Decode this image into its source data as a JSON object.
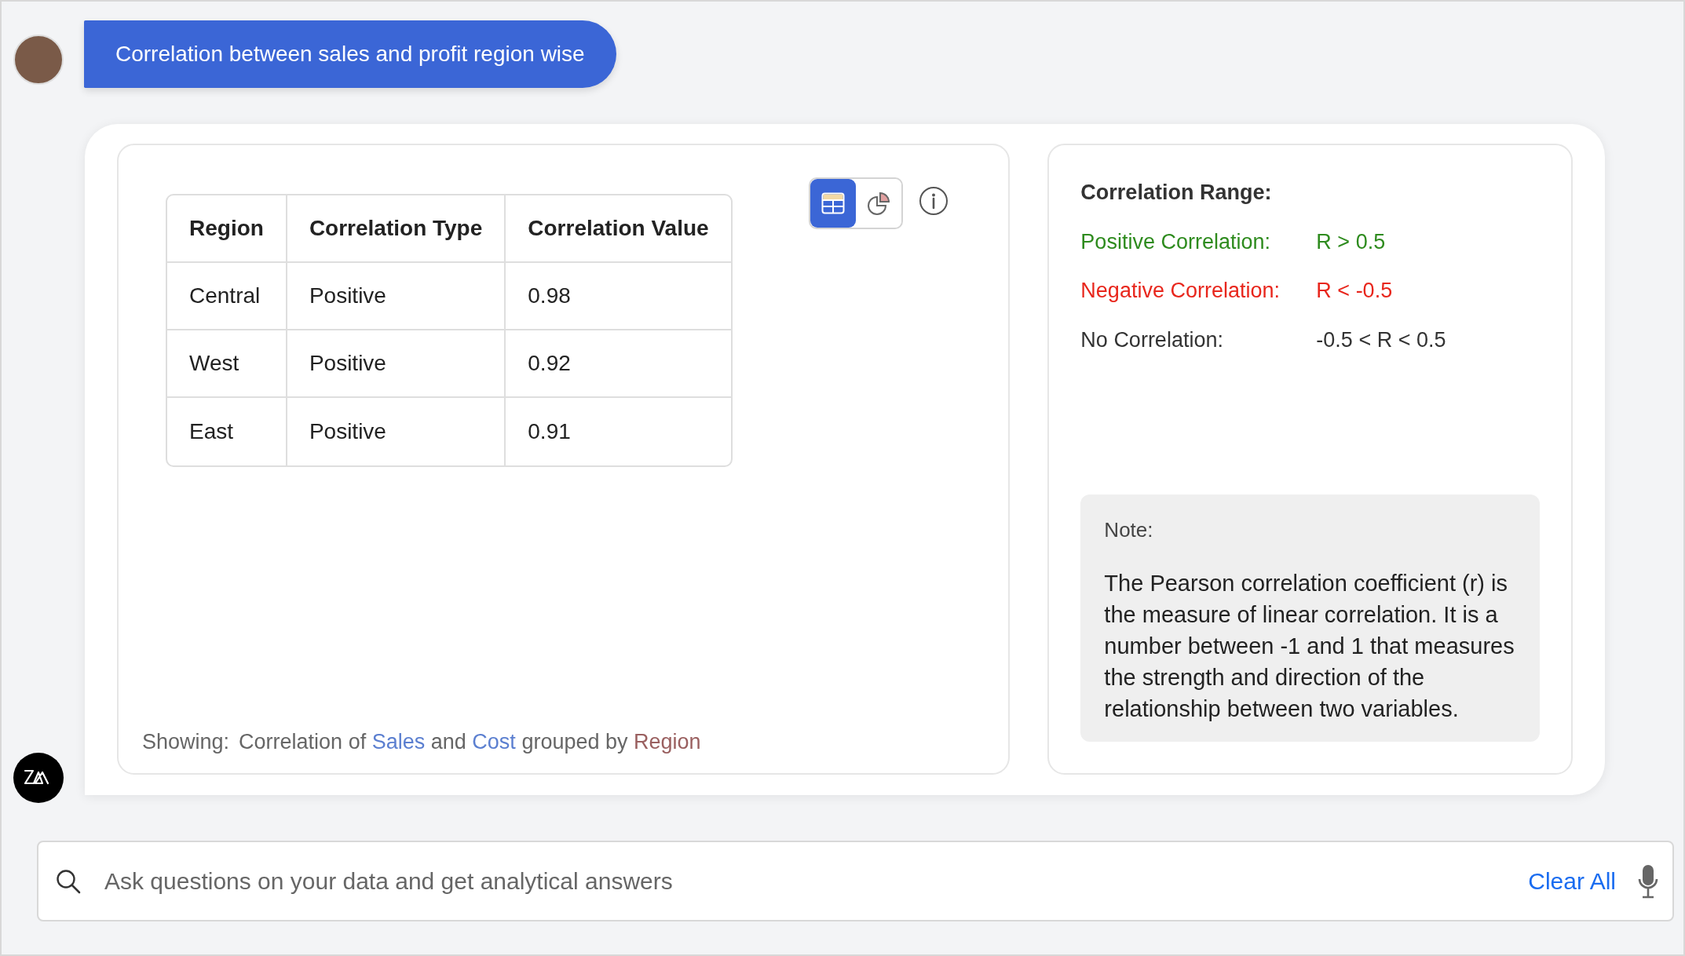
{
  "message": {
    "text": "Correlation between sales and profit region wise"
  },
  "view_toggle": [
    {
      "kind": "table",
      "selected": true
    },
    {
      "kind": "chart",
      "selected": false
    }
  ],
  "table": {
    "columns": [
      "Region",
      "Correlation Type",
      "Correlation Value"
    ],
    "rows": [
      [
        "Central",
        "Positive",
        "0.98"
      ],
      [
        "West",
        "Positive",
        "0.92"
      ],
      [
        "East",
        "Positive",
        "0.91"
      ]
    ]
  },
  "showing": {
    "label": "Showing:",
    "parts": [
      {
        "text": "Correlation of",
        "kind": "plain"
      },
      {
        "text": "Sales",
        "kind": "measure"
      },
      {
        "text": "and",
        "kind": "plain"
      },
      {
        "text": "Cost",
        "kind": "measure"
      },
      {
        "text": "grouped by",
        "kind": "plain"
      },
      {
        "text": "Region",
        "kind": "dimension"
      }
    ]
  },
  "correlation_range": {
    "title": "Correlation Range:",
    "items": [
      {
        "label": "Positive Correlation:",
        "value": "R > 0.5",
        "color": "#2e8b1e"
      },
      {
        "label": "Negative Correlation:",
        "value": "R < -0.5",
        "color": "#e8261c"
      },
      {
        "label": "No Correlation:",
        "value": "-0.5 < R < 0.5",
        "color": "#333333"
      }
    ]
  },
  "note": {
    "title": "Note:",
    "text": "The Pearson correlation coefficient (r) is the measure of linear correlation. It is a number between -1 and 1 that measures the strength and direction of the relationship between two variables."
  },
  "search": {
    "placeholder": "Ask questions on your data and get analytical answers",
    "clear_label": "Clear All"
  }
}
